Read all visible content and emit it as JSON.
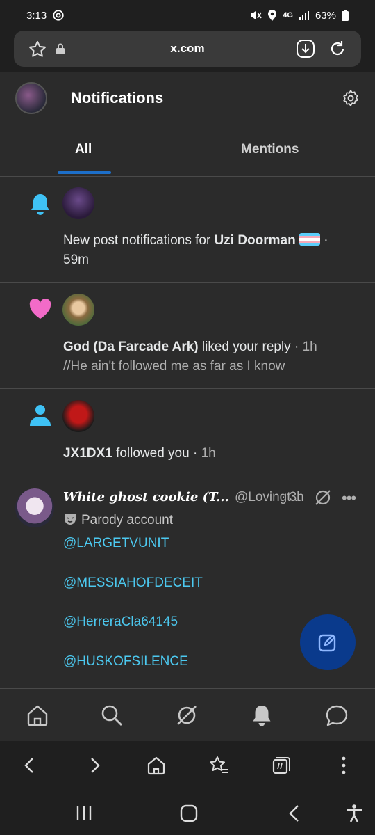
{
  "status": {
    "time": "3:13",
    "battery": "63%",
    "network": "4G"
  },
  "browser": {
    "url": "x.com"
  },
  "header": {
    "title": "Notifications"
  },
  "tabs": {
    "all": "All",
    "mentions": "Mentions"
  },
  "notifications": [
    {
      "type": "new-post",
      "prefix": "New post notifications for ",
      "name": "Uzi Doorman",
      "suffix": " ·",
      "time": "59m"
    },
    {
      "type": "like",
      "name": "God (Da Farcade Ark)",
      "action": " liked your reply · ",
      "time": "1h",
      "detail": "//He ain't followed me as far as I know"
    },
    {
      "type": "follow",
      "name": "JX1DX1",
      "action": " followed you · ",
      "time": "1h"
    }
  ],
  "tweet": {
    "name": "White ghost cookie (T...",
    "handle": "@Lovingt...",
    "time": "· 3h",
    "label": "Parody account",
    "mentions": [
      "@LARGETVUNIT",
      "@MESSIAHOFDECEIT",
      "@HerreraCla64145",
      "@HUSKOFSILENCE"
    ]
  },
  "colors": {
    "accent": "#1d6fc9",
    "link": "#4cc9f0",
    "bell": "#3fc2f5",
    "heart": "#f26bc8",
    "fab": "#0a3a8c"
  }
}
